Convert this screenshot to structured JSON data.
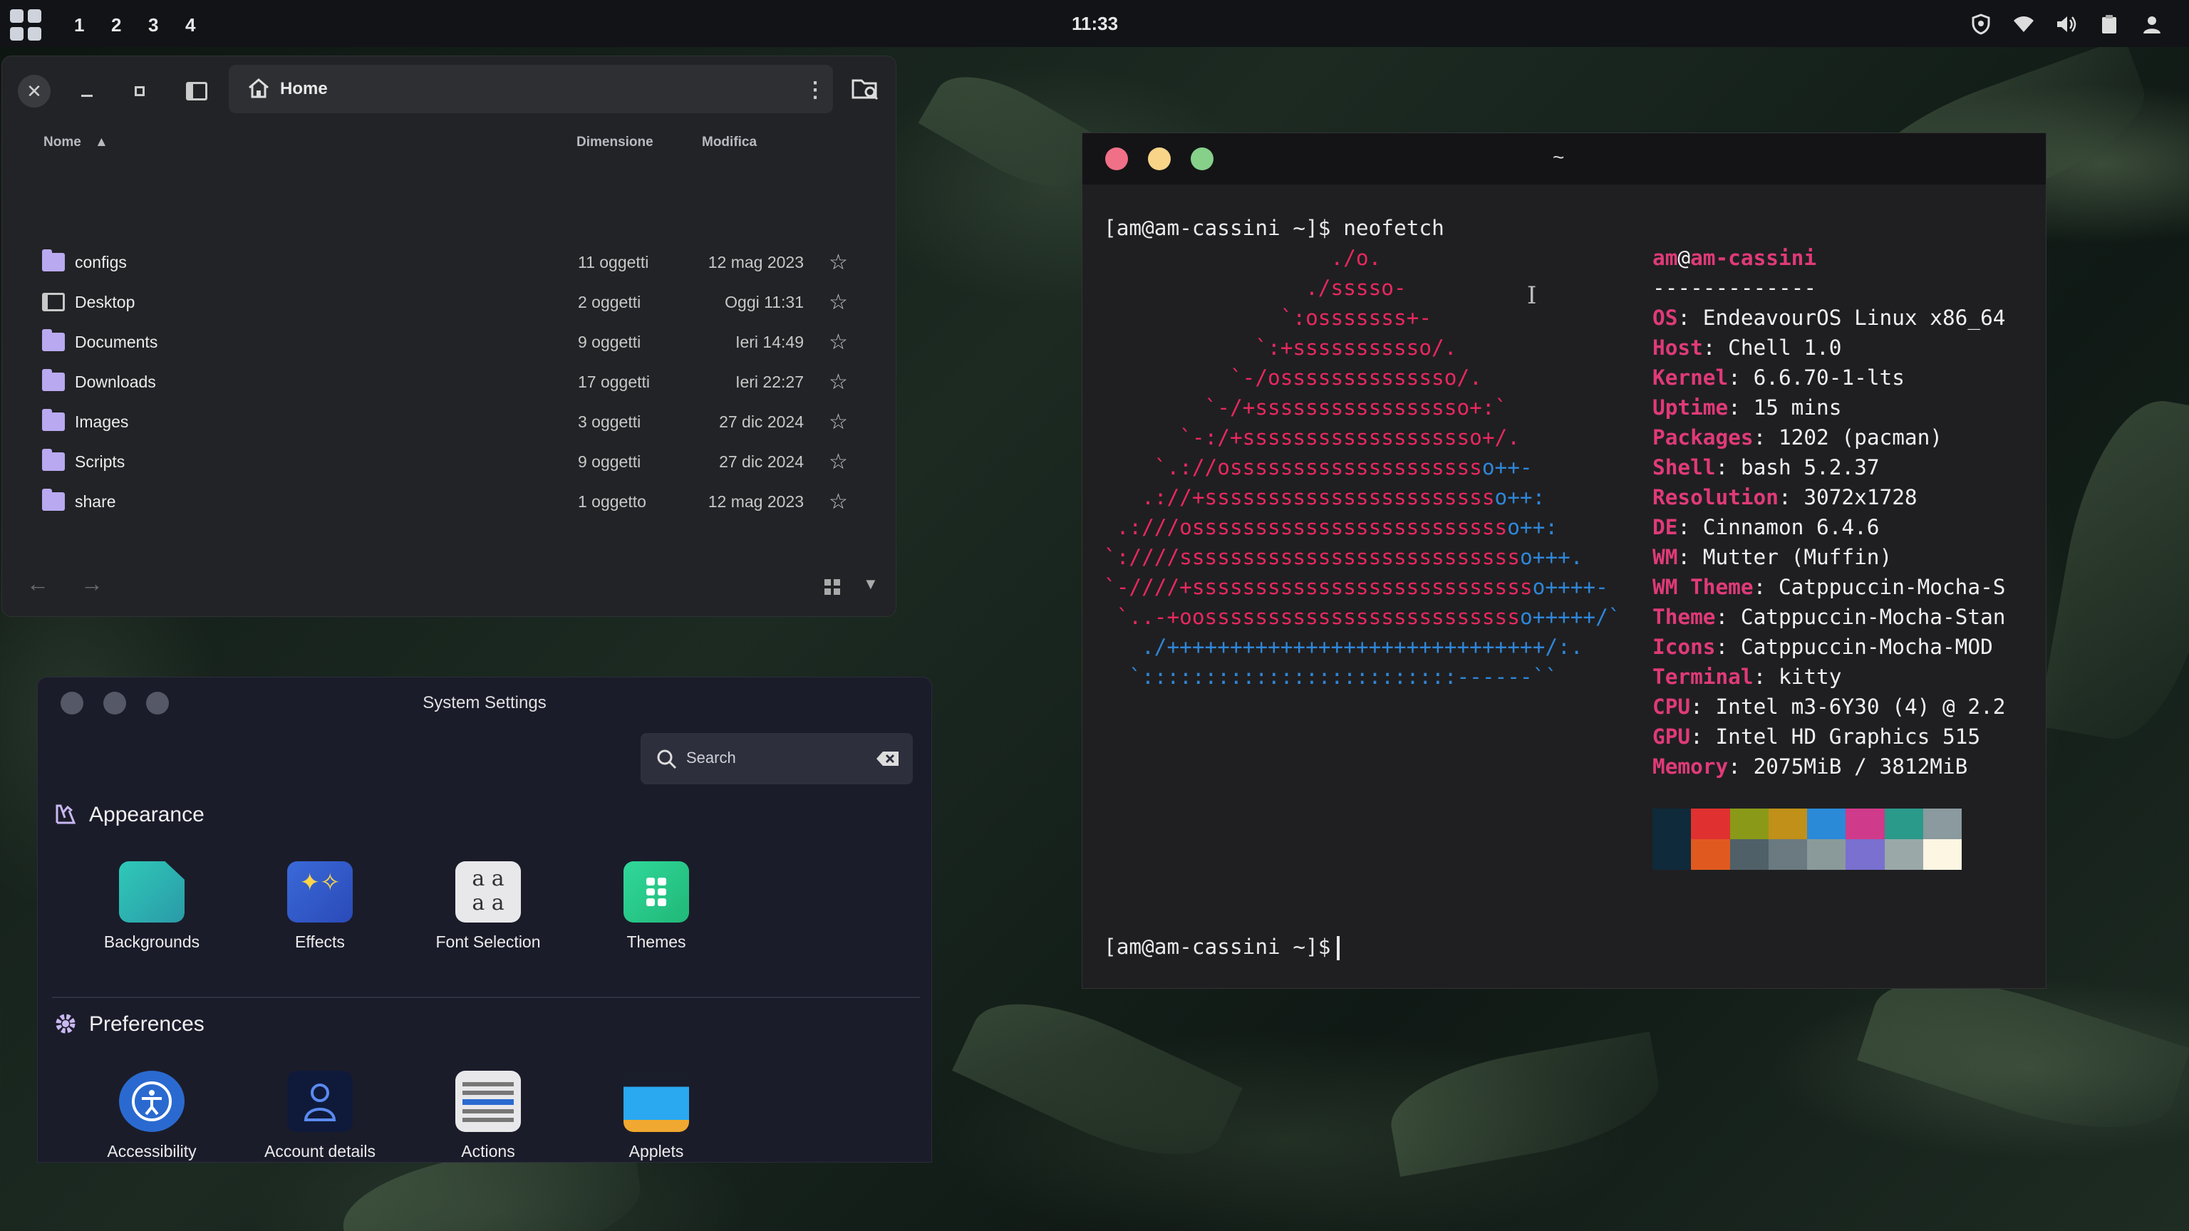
{
  "panel": {
    "workspaces": [
      "1",
      "2",
      "3",
      "4"
    ],
    "clock": "11:33",
    "tray_icons": [
      "shield-icon",
      "wifi-icon",
      "volume-icon",
      "clipboard-icon",
      "user-icon"
    ]
  },
  "file_manager": {
    "location": "Home",
    "columns": {
      "name": "Nome",
      "size": "Dimensione",
      "modified": "Modifica"
    },
    "rows": [
      {
        "name": "configs",
        "size": "11 oggetti",
        "date": "12 mag 2023",
        "icon": "folder-icon"
      },
      {
        "name": "Desktop",
        "size": "2 oggetti",
        "date": "Oggi 11:31",
        "icon": "desktop-icon"
      },
      {
        "name": "Documents",
        "size": "9 oggetti",
        "date": "Ieri 14:49",
        "icon": "folder-icon"
      },
      {
        "name": "Downloads",
        "size": "17 oggetti",
        "date": "Ieri 22:27",
        "icon": "folder-icon"
      },
      {
        "name": "Images",
        "size": "3 oggetti",
        "date": "27 dic 2024",
        "icon": "folder-icon"
      },
      {
        "name": "Scripts",
        "size": "9 oggetti",
        "date": "27 dic 2024",
        "icon": "folder-icon"
      },
      {
        "name": "share",
        "size": "1 oggetto",
        "date": "12 mag 2023",
        "icon": "folder-icon"
      }
    ]
  },
  "terminal": {
    "title": "~",
    "prompt": "[am@am-cassini ~]$",
    "command": "neofetch",
    "user": "am",
    "at": "@",
    "host": "am-cassini",
    "separator": "-------------",
    "info": [
      {
        "key": "OS",
        "value": "EndeavourOS Linux x86_64"
      },
      {
        "key": "Host",
        "value": "Chell 1.0"
      },
      {
        "key": "Kernel",
        "value": "6.6.70-1-lts"
      },
      {
        "key": "Uptime",
        "value": "15 mins"
      },
      {
        "key": "Packages",
        "value": "1202 (pacman)"
      },
      {
        "key": "Shell",
        "value": "bash 5.2.37"
      },
      {
        "key": "Resolution",
        "value": "3072x1728"
      },
      {
        "key": "DE",
        "value": "Cinnamon 6.4.6"
      },
      {
        "key": "WM",
        "value": "Mutter (Muffin)"
      },
      {
        "key": "WM Theme",
        "value": "Catppuccin-Mocha-S"
      },
      {
        "key": "Theme",
        "value": "Catppuccin-Mocha-Stan"
      },
      {
        "key": "Icons",
        "value": "Catppuccin-Mocha-MOD"
      },
      {
        "key": "Terminal",
        "value": "kitty"
      },
      {
        "key": "CPU",
        "value": "Intel m3-6Y30 (4) @ 2.2"
      },
      {
        "key": "GPU",
        "value": "Intel HD Graphics 515"
      },
      {
        "key": "Memory",
        "value": "2075MiB / 3812MiB"
      }
    ],
    "palette": [
      "#0f2a3a",
      "#e03030",
      "#8a9a18",
      "#c09018",
      "#2a8ad8",
      "#d03a8a",
      "#2a9a8a",
      "#8a9a9e",
      "#0f2a3a",
      "#e05a20",
      "#506068",
      "#6a7a80",
      "#8a9a9a",
      "#7a70d0",
      "#9aa8a8",
      "#fdf6e3"
    ],
    "ascii": [
      {
        "t": "                  ./o.",
        "c": "r"
      },
      {
        "t": "                ./sssso-",
        "c": "r"
      },
      {
        "t": "              `:osssssss+-",
        "c": "r"
      },
      {
        "t": "            `:+sssssssssso/.",
        "c": "r"
      },
      {
        "t": "          `-/ossssssssssssso/.",
        "c": "r"
      },
      {
        "t": "        `-/+sssssssssssssssso+:`",
        "c": "r"
      },
      {
        "t": "      `-:/+sssssssssssssssssso+/.",
        "c": "r"
      },
      {
        "t": "    `.://osssssssssssssssssssso++-",
        "c": "rb"
      },
      {
        "t": "   .://+ssssssssssssssssssssssso++:",
        "c": "rb"
      },
      {
        "t": " .:///ossssssssssssssssssssssssso++:",
        "c": "rb"
      },
      {
        "t": "`:////ssssssssssssssssssssssssssso+++.",
        "c": "rb"
      },
      {
        "t": "`-////+ssssssssssssssssssssssssssso++++-",
        "c": "rb"
      },
      {
        "t": " `..-+oossssssssssssssssssssssssso+++++/`",
        "c": "rb"
      },
      {
        "t": "   ./++++++++++++++++++++++++++++++/:.",
        "c": "b"
      },
      {
        "t": "  `:::::::::::::::::::::::::------``",
        "c": "b"
      }
    ]
  },
  "settings": {
    "title": "System Settings",
    "search_placeholder": "Search",
    "sections": [
      {
        "title": "Appearance",
        "items": [
          "Backgrounds",
          "Effects",
          "Font Selection",
          "Themes"
        ]
      },
      {
        "title": "Preferences",
        "items": [
          "Accessibility",
          "Account details",
          "Actions",
          "Applets"
        ]
      }
    ]
  }
}
